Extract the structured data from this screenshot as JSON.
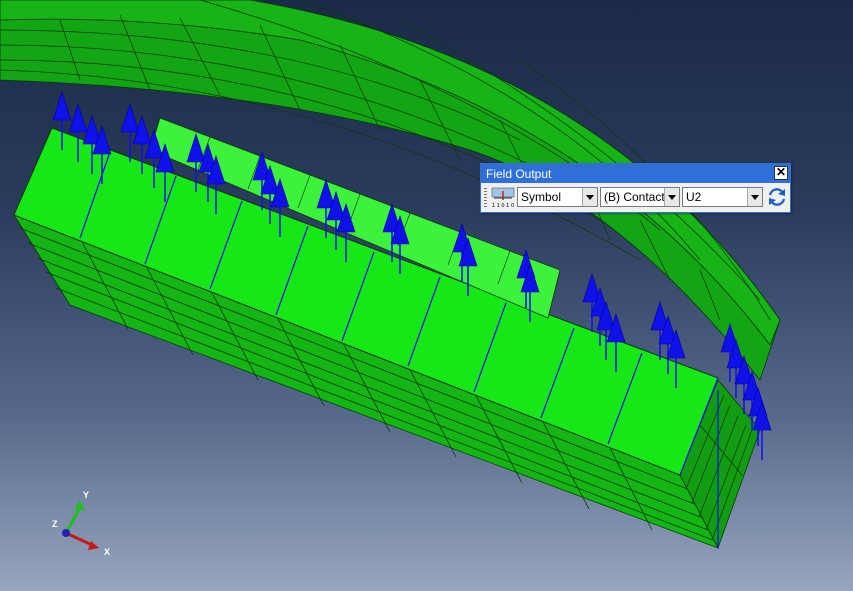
{
  "field_output": {
    "title": "Field Output",
    "close_glyph": "✕",
    "plot_mode": "Symbol",
    "step_selector": "(B) Contact:",
    "variable": "U2",
    "icon_caption": "1 1 0 1 0"
  },
  "triad": {
    "x_label": "X",
    "y_label": "Y",
    "z_label": "Z"
  },
  "colors": {
    "mesh_top": "#14e614",
    "mesh_side": "#14b514",
    "mesh_back": "#0fa00f",
    "arrow": "#1010e8",
    "titlebar": "#2f6fd8"
  }
}
